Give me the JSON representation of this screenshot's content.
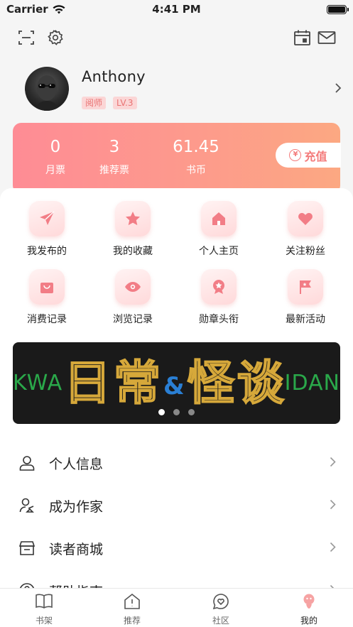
{
  "status": {
    "carrier": "Carrier",
    "time": "4:41 PM"
  },
  "topbar": {
    "scan_icon": "scan-icon",
    "settings_icon": "gear-icon",
    "calendar_icon": "calendar-icon",
    "mail_icon": "mail-icon"
  },
  "profile": {
    "name": "Anthony",
    "tags": [
      "阅师",
      "LV.3"
    ]
  },
  "wallet": {
    "stats": [
      {
        "value": "0",
        "label": "月票"
      },
      {
        "value": "3",
        "label": "推荐票"
      },
      {
        "value": "61.45",
        "label": "书币"
      }
    ],
    "recharge_label": "充值",
    "recharge_symbol": "¥"
  },
  "grid": [
    {
      "label": "我发布的",
      "icon": "paper-plane-icon"
    },
    {
      "label": "我的收藏",
      "icon": "star-icon"
    },
    {
      "label": "个人主页",
      "icon": "home-icon"
    },
    {
      "label": "关注粉丝",
      "icon": "heart-icon"
    },
    {
      "label": "消费记录",
      "icon": "bag-icon"
    },
    {
      "label": "浏览记录",
      "icon": "eye-icon"
    },
    {
      "label": "勋章头衔",
      "icon": "medal-icon"
    },
    {
      "label": "最新活动",
      "icon": "flag-icon"
    }
  ],
  "banner": {
    "title": "日常",
    "amp": "&",
    "title2": "怪谈",
    "left_text": "KWA",
    "right_text": "IDAN",
    "page_count": 3,
    "active_page": 1
  },
  "menu": [
    {
      "label": "个人信息",
      "icon": "user-icon"
    },
    {
      "label": "成为作家",
      "icon": "writer-icon"
    },
    {
      "label": "读者商城",
      "icon": "store-icon"
    },
    {
      "label": "帮助指南",
      "icon": "help-icon"
    }
  ],
  "tabs": [
    {
      "label": "书架",
      "icon": "book-icon"
    },
    {
      "label": "推荐",
      "icon": "recommend-icon"
    },
    {
      "label": "社区",
      "icon": "community-icon"
    },
    {
      "label": "我的",
      "icon": "profile-icon"
    }
  ],
  "colors": {
    "accent": "#f47c7c",
    "wallet_start": "#fe8c95",
    "wallet_end": "#fca882",
    "tag_bg": "#fbd6d6",
    "tag_text": "#e97373"
  }
}
